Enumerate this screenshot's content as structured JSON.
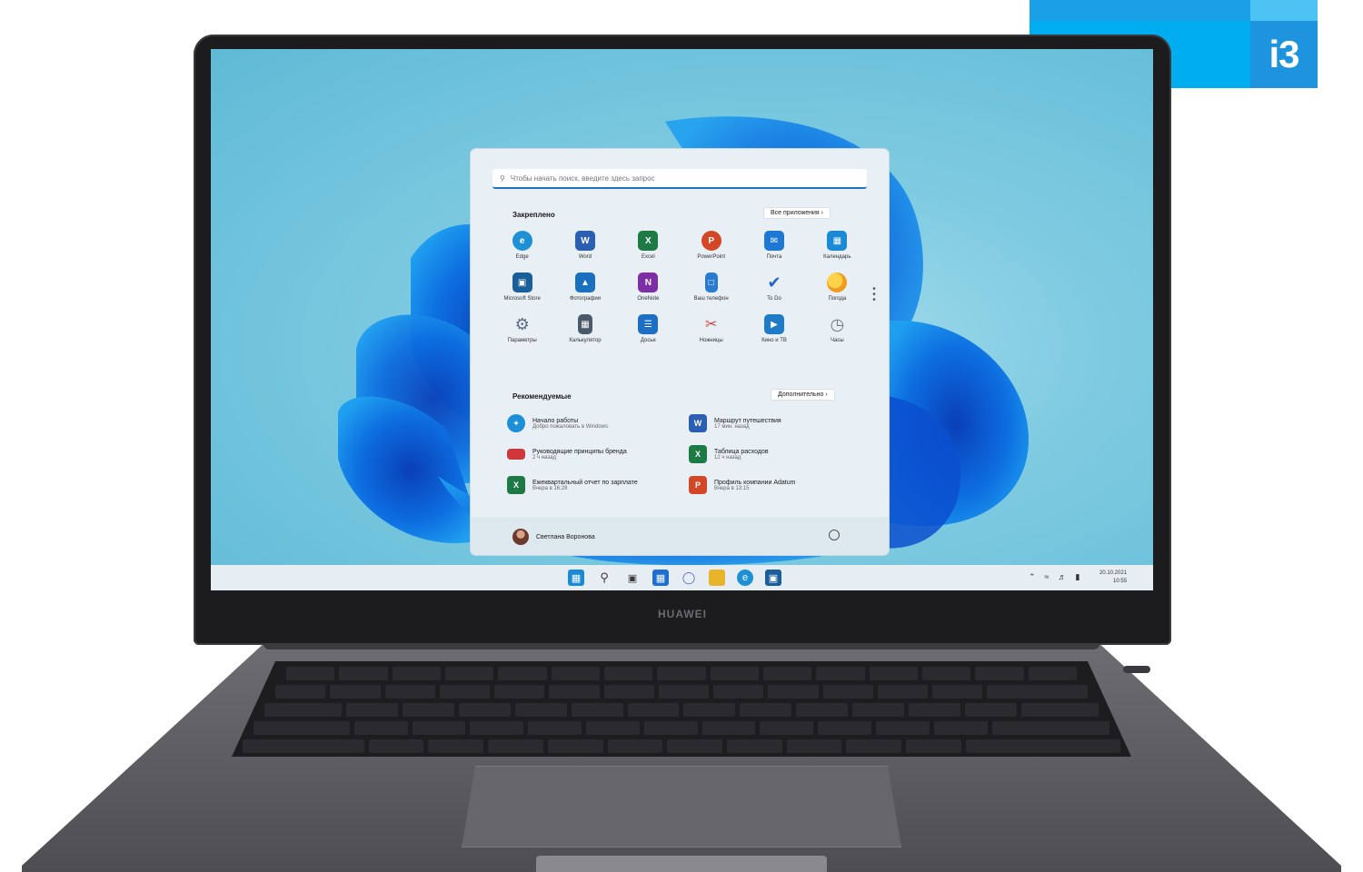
{
  "badge": {
    "text": "i3"
  },
  "laptop": {
    "brand": "HUAWEI"
  },
  "start_menu": {
    "search_placeholder": "Чтобы начать поиск, введите здесь запрос",
    "pinned": {
      "title": "Закреплено",
      "all_apps_label": "Все приложения  ›",
      "apps": [
        {
          "label": "Edge",
          "icon": "edge-icon",
          "color": "#1f8fd6"
        },
        {
          "label": "Word",
          "icon": "word-icon",
          "color": "#2b5fb4"
        },
        {
          "label": "Excel",
          "icon": "excel-icon",
          "color": "#1e7a45"
        },
        {
          "label": "PowerPoint",
          "icon": "powerpoint-icon",
          "color": "#d24726"
        },
        {
          "label": "Почта",
          "icon": "mail-icon",
          "color": "#1c78d4"
        },
        {
          "label": "Календарь",
          "icon": "calendar-icon",
          "color": "#1a8ad6"
        },
        {
          "label": "Microsoft Store",
          "icon": "store-icon",
          "color": "#1a5e9a"
        },
        {
          "label": "Фотографии",
          "icon": "photos-icon",
          "color": "#1b6fbf"
        },
        {
          "label": "OneNote",
          "icon": "onenote-icon",
          "color": "#7d2fa6"
        },
        {
          "label": "Ваш телефон",
          "icon": "phone-icon",
          "color": "#2a7bd0"
        },
        {
          "label": "To Do",
          "icon": "todo-icon",
          "color": "#2564cf"
        },
        {
          "label": "Погода",
          "icon": "weather-icon",
          "color": "#f0a020"
        },
        {
          "label": "Параметры",
          "icon": "settings-icon",
          "color": "#5a6a80"
        },
        {
          "label": "Калькулятор",
          "icon": "calculator-icon",
          "color": "#4a5a68"
        },
        {
          "label": "Досье",
          "icon": "news-icon",
          "color": "#1d6fc4"
        },
        {
          "label": "Ножницы",
          "icon": "snipping-icon",
          "color": "#d0473a"
        },
        {
          "label": "Кино и ТВ",
          "icon": "movies-icon",
          "color": "#1f7bc7"
        },
        {
          "label": "Часы",
          "icon": "clock-icon",
          "color": "#6d7a86"
        }
      ]
    },
    "recommended": {
      "title": "Рекомендуемые",
      "more_label": "Дополнительно  ›",
      "items": [
        {
          "title": "Начало работы",
          "subtitle": "Добро пожаловать в Windows",
          "icon": "getstarted-icon",
          "color": "#1c8fd6"
        },
        {
          "title": "Маршрут путешествия",
          "subtitle": "17 мин. назад",
          "icon": "word-doc-icon",
          "color": "#2b5fb4"
        },
        {
          "title": "Руководящие принципы бренда",
          "subtitle": "2 ч назад",
          "icon": "pdf-icon",
          "color": "#d0373a"
        },
        {
          "title": "Таблица расходов",
          "subtitle": "12 ч назад",
          "icon": "excel-doc-icon",
          "color": "#1e7a45"
        },
        {
          "title": "Ежеквартальный отчет по зарплате",
          "subtitle": "Вчера в 16:28",
          "icon": "excel-doc-icon",
          "color": "#1e7a45"
        },
        {
          "title": "Профиль компании Adatum",
          "subtitle": "Вчера в 13:15",
          "icon": "ppt-doc-icon",
          "color": "#d24726"
        }
      ]
    },
    "user": {
      "name": "Светлана Воронова"
    }
  },
  "taskbar": {
    "icons": [
      {
        "name": "start-icon",
        "color": "#1a8ad6"
      },
      {
        "name": "search-icon",
        "color": "#3a3a3a"
      },
      {
        "name": "taskview-icon",
        "color": "#3a3a3a"
      },
      {
        "name": "widgets-icon",
        "color": "#1e6fd0"
      },
      {
        "name": "chat-icon",
        "color": "#5a62c8"
      },
      {
        "name": "explorer-icon",
        "color": "#e8b42a"
      },
      {
        "name": "edge-icon",
        "color": "#1f8fd6"
      },
      {
        "name": "store-icon",
        "color": "#1a5e9a"
      }
    ],
    "date": "20.10.2021",
    "time": "10:55"
  }
}
